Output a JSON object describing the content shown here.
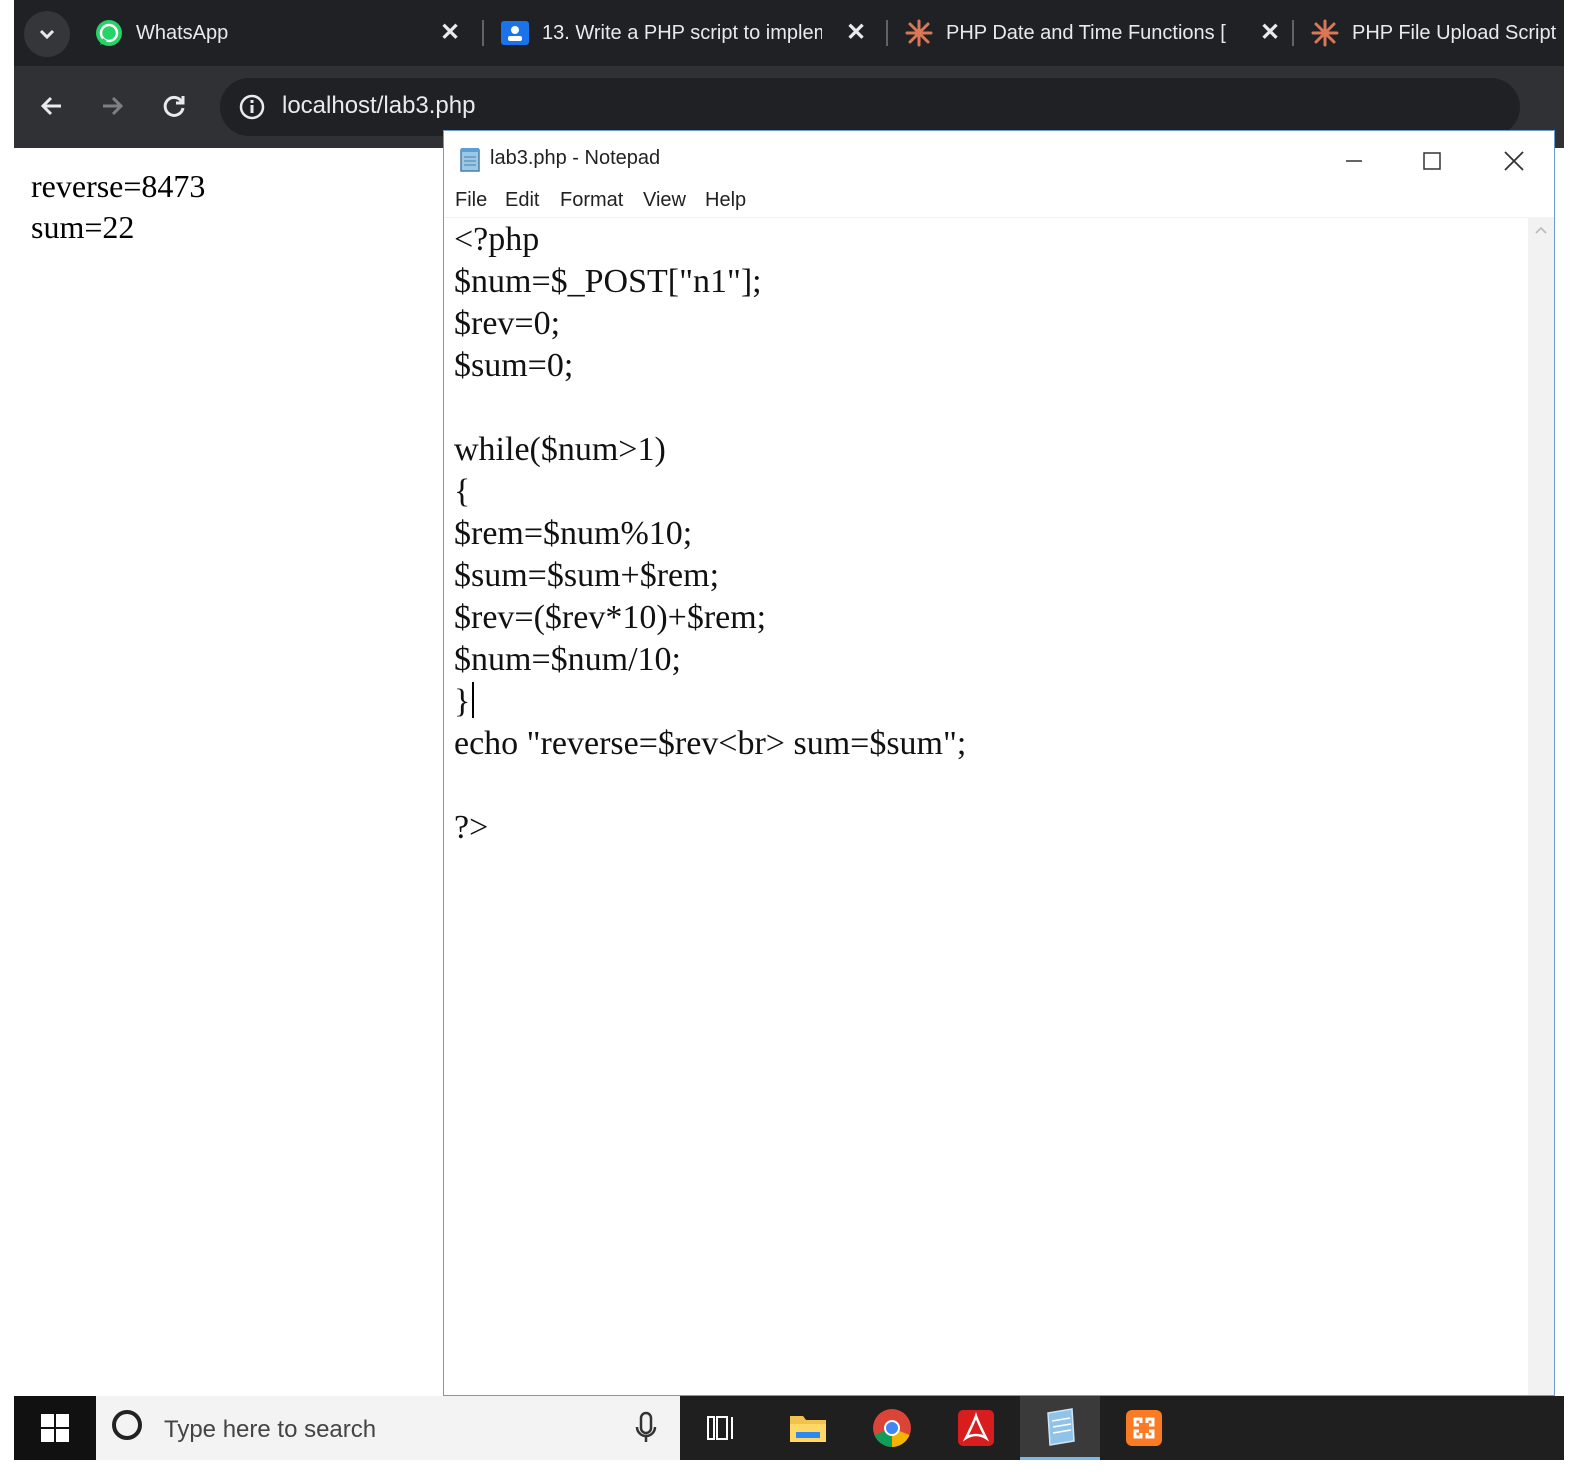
{
  "browser": {
    "tabs": [
      {
        "title": "WhatsApp",
        "icon": "whatsapp-icon"
      },
      {
        "title": "13. Write a PHP script to implem",
        "icon": "classroom-icon"
      },
      {
        "title": "PHP Date and Time Functions [",
        "icon": "claude-icon"
      },
      {
        "title": "PHP File Upload Script -",
        "icon": "claude-icon"
      }
    ],
    "url": "localhost/lab3.php",
    "output_lines": [
      "reverse=8473",
      "sum=22"
    ]
  },
  "notepad": {
    "title": "lab3.php - Notepad",
    "menu": [
      "File",
      "Edit",
      "Format",
      "View",
      "Help"
    ],
    "code_lines": [
      "<?php",
      "$num=$_POST[\"n1\"];",
      "$rev=0;",
      "$sum=0;",
      "",
      "while($num>1)",
      "{",
      "$rem=$num%10;",
      "$sum=$sum+$rem;",
      "$rev=($rev*10)+$rem;",
      "$num=$num/10;",
      "}",
      "echo \"reverse=$rev<br> sum=$sum\";",
      "",
      "?>"
    ]
  },
  "taskbar": {
    "search_placeholder": "Type here to search",
    "icons": [
      "task-view-icon",
      "file-explorer-icon",
      "chrome-icon",
      "acrobat-icon",
      "notepad-icon",
      "xampp-icon"
    ]
  },
  "colors": {
    "chrome_dark": "#202124",
    "chrome_toolbar": "#303134",
    "notepad_border": "#6b9bd2",
    "whatsapp_green": "#25d366",
    "claude_orange": "#d97757",
    "xampp_orange": "#fb7a24"
  }
}
